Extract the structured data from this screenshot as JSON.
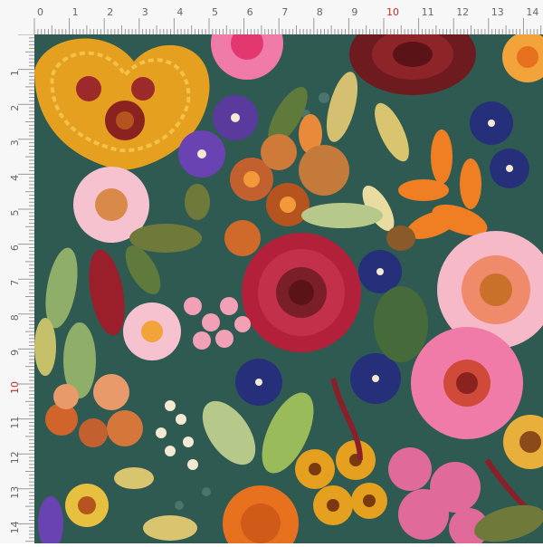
{
  "ruler": {
    "unit_labels": [
      "0",
      "1",
      "2",
      "3",
      "4",
      "5",
      "6",
      "7",
      "8",
      "9",
      "10",
      "11",
      "12",
      "13",
      "14"
    ],
    "highlight_label": "10",
    "highlight_color": "#c62828",
    "label_color": "#666666"
  },
  "colors": {
    "fabric": "#2f5a52",
    "fabric_dark": "#244843",
    "crimson": "#b3203a",
    "orange": "#e8711f",
    "gold": "#e6a020",
    "pink": "#f07aa8",
    "light_pink": "#f6c2d0",
    "navy": "#26307a",
    "purple": "#5a3a9c",
    "olive": "#6f7a3a",
    "sage": "#8fae6a",
    "cream": "#e9dca0",
    "maroon": "#7a1f28",
    "rust": "#b5541e"
  }
}
